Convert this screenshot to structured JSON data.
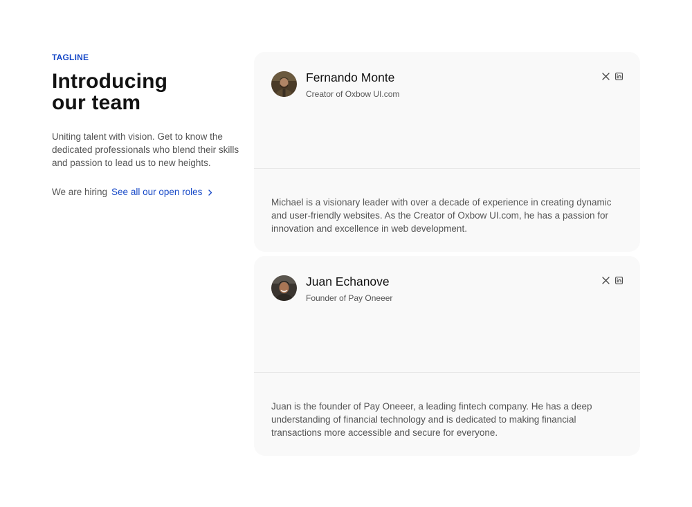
{
  "intro": {
    "tagline": "TAGLINE",
    "title_line1": "Introducing",
    "title_line2": "our team",
    "description": "Uniting talent with vision. Get to know the dedicated professionals who blend their skills and passion to lead us to new heights.",
    "hiring_text": "We are hiring",
    "roles_link": "See all our open roles"
  },
  "colors": {
    "accent": "#1648c7",
    "card_bg": "#f9f9f9",
    "body_text": "#555555"
  },
  "team": [
    {
      "name": "Fernando Monte",
      "role": "Creator of Oxbow UI.com",
      "bio": "Michael is a visionary leader with over a decade of experience in creating dynamic and user-friendly websites. As the Creator of Oxbow UI.com, he has a passion for innovation and excellence in web development.",
      "socials": [
        "x-icon",
        "linkedin-icon"
      ]
    },
    {
      "name": "Juan Echanove",
      "role": "Founder of Pay Oneeer",
      "bio": "Juan is the founder of Pay Oneeer, a leading fintech company. He has a deep understanding of financial technology and is dedicated to making financial transactions more accessible and secure for everyone.",
      "socials": [
        "x-icon",
        "linkedin-icon"
      ]
    }
  ]
}
